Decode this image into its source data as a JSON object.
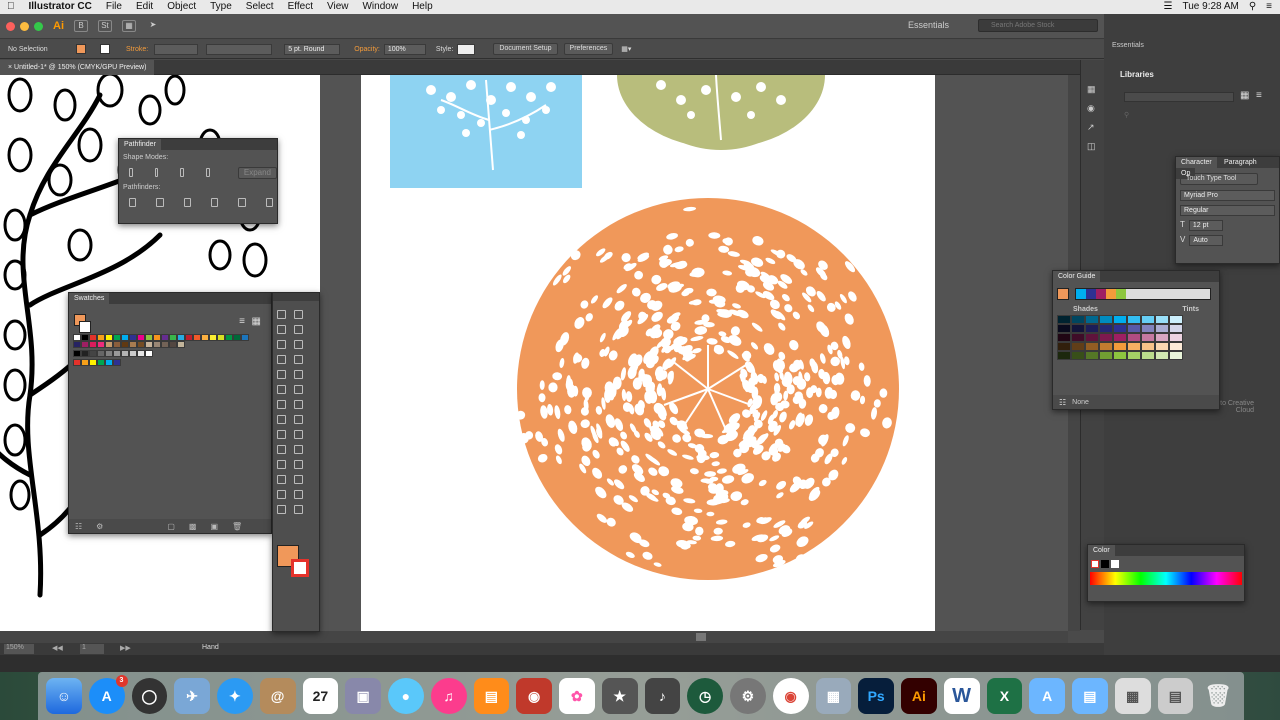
{
  "menubar": {
    "app": "Illustrator CC",
    "items": [
      "File",
      "Edit",
      "Object",
      "Type",
      "Select",
      "Effect",
      "View",
      "Window",
      "Help"
    ],
    "clock": "Tue 9:28 AM"
  },
  "appbar": {
    "badge": "Ai",
    "workspace": "Essentials",
    "search_placeholder": "Search Adobe Stock"
  },
  "control": {
    "selection": "No Selection",
    "stroke_label": "Stroke:",
    "brush": "5 pt. Round",
    "opacity_label": "Opacity:",
    "opacity_value": "100%",
    "style_label": "Style:",
    "doc_setup": "Document Setup",
    "preferences": "Preferences"
  },
  "document": {
    "tab": "Untitled-1* @ 150% (CMYK/GPU Preview)"
  },
  "pathfinder": {
    "title": "Pathfinder",
    "shape_modes": "Shape Modes:",
    "pathfinders": "Pathfinders:",
    "expand": "Expand"
  },
  "swatches": {
    "title": "Swatches",
    "colors": [
      "#ffffff",
      "#000000",
      "#e4322b",
      "#f6a01a",
      "#fff200",
      "#00a651",
      "#00aeef",
      "#2e3192",
      "#ec008c",
      "#8dc63f",
      "#f7941d",
      "#662d91",
      "#39b54a",
      "#27aae1",
      "#be1e2d",
      "#f15a29",
      "#fbb040",
      "#f9ed32",
      "#d7df23",
      "#009444",
      "#006838",
      "#1c75bc",
      "#262262",
      "#9e1f63",
      "#da1c5c",
      "#ee2a7b",
      "#c49a6c",
      "#8b5e3c",
      "#603913",
      "#a97c50",
      "#754c24",
      "#c7b299",
      "#998675",
      "#736357",
      "#534741",
      "#c2b59b"
    ],
    "grays": [
      "#000000",
      "#222222",
      "#444444",
      "#666666",
      "#808080",
      "#999999",
      "#b3b3b3",
      "#cccccc",
      "#e6e6e6",
      "#ffffff"
    ],
    "group2": [
      "#e4322b",
      "#f6a01a",
      "#fff200",
      "#00a651",
      "#00aeef",
      "#2e3192"
    ]
  },
  "color_guide": {
    "title": "Color Guide",
    "shades": "Shades",
    "tints": "Tints",
    "none": "None",
    "harmony": [
      "#00aeef",
      "#2e3192",
      "#9e1f63",
      "#f39b3b",
      "#8dc63f"
    ]
  },
  "character": {
    "tabs": [
      "Character",
      "Paragraph",
      "Op"
    ],
    "touch_type": "Touch Type Tool",
    "font": "Myriad Pro",
    "style": "Regular",
    "size": "12 pt",
    "leading": "Auto"
  },
  "color_panel": {
    "title": "Color"
  },
  "libraries": {
    "title": "Libraries",
    "msg": "Libraries, please sign in to Creative Cloud"
  },
  "status": {
    "zoom": "150%",
    "page": "1",
    "tool": "Hand"
  },
  "essentials2": "Essentials",
  "art": {
    "orange": "#f0985a",
    "blue": "#8ed3f2",
    "olive": "#b8bd7c"
  },
  "dock": {
    "items": [
      "Finder",
      "App Store",
      "Dashboard",
      "Preview",
      "Safari",
      "Contacts",
      "Calendar",
      "Photos",
      "Messages",
      "iTunes",
      "iBooks",
      "Photo Booth",
      "Photos",
      "iMovie",
      "GarageBand",
      "Time Machine",
      "System Preferences",
      "Chrome",
      "Preview",
      "Ps",
      "Ai",
      "W",
      "Excel",
      "Folder",
      "Folder",
      "Docs",
      "Notes",
      "Trash"
    ],
    "calendar_day": "27",
    "appstore_badge": "3"
  },
  "icons": [
    "apple-icon",
    "search-icon",
    "hand-tool-icon",
    "selection-tool-icon",
    "pen-tool-icon",
    "type-tool-icon",
    "swatch-grid-icon",
    "trash-icon"
  ]
}
